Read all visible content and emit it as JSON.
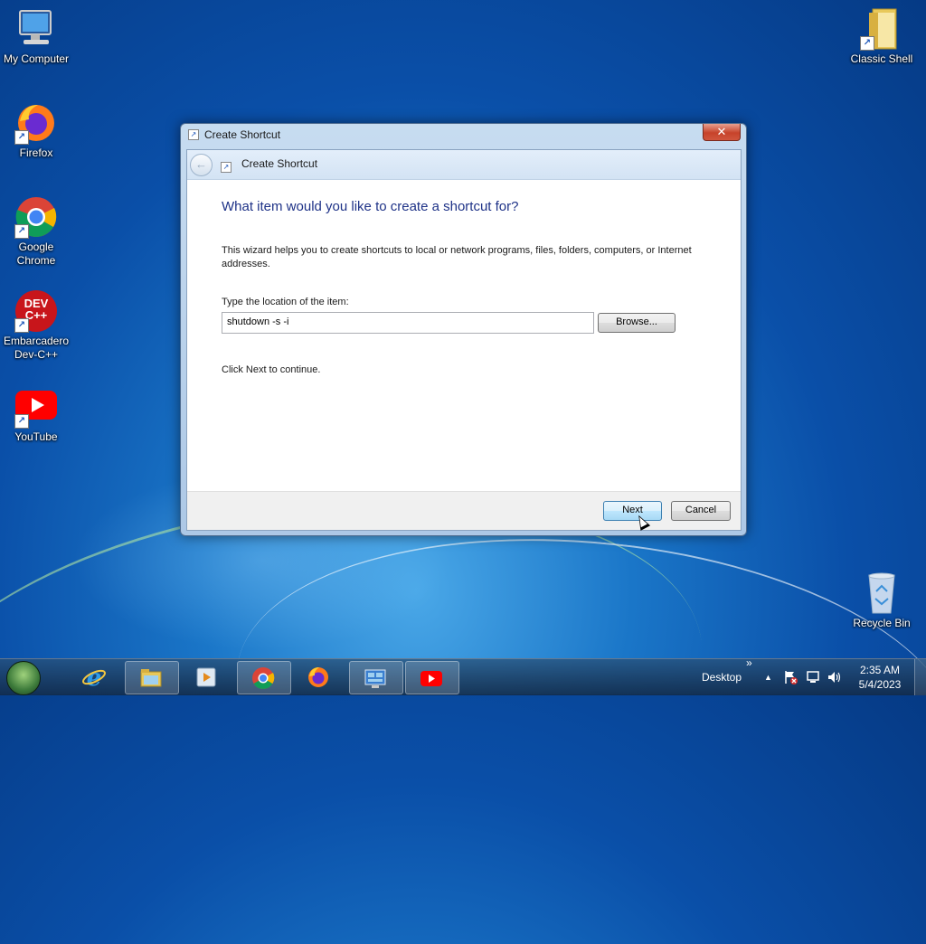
{
  "desktop": {
    "icons": [
      {
        "label": "My Computer",
        "icon": "computer-icon"
      },
      {
        "label": "Firefox",
        "icon": "firefox-icon"
      },
      {
        "label": "Google Chrome",
        "icon": "chrome-icon"
      },
      {
        "label": "Embarcadero Dev-C++",
        "icon": "devcpp-icon"
      },
      {
        "label": "YouTube",
        "icon": "youtube-icon"
      },
      {
        "label": "Classic Shell",
        "icon": "folder-icon"
      },
      {
        "label": "Recycle Bin",
        "icon": "recycle-bin-icon"
      }
    ],
    "devcpp_logo_text": "DEV\nC++"
  },
  "dialog": {
    "title": "Create Shortcut",
    "close_glyph": "✕",
    "nav_title": "Create Shortcut",
    "back_glyph": "←",
    "heading": "What item would you like to create a shortcut for?",
    "description": "This wizard helps you to create shortcuts to local or network programs, files, folders, computers, or Internet addresses.",
    "location_label": "Type the location of the item:",
    "location_value": "shutdown -s -i",
    "browse_label": "Browse...",
    "continue_text": "Click Next to continue.",
    "next_label": "Next",
    "cancel_label": "Cancel"
  },
  "taskbar": {
    "items": [
      {
        "icon": "internet-explorer-icon",
        "pinned": false
      },
      {
        "icon": "file-explorer-icon",
        "pinned": true
      },
      {
        "icon": "media-player-icon",
        "pinned": false
      },
      {
        "icon": "chrome-icon",
        "pinned": true
      },
      {
        "icon": "firefox-icon",
        "pinned": false
      },
      {
        "icon": "control-panel-icon",
        "pinned": true
      },
      {
        "icon": "youtube-icon",
        "pinned": true
      }
    ],
    "desktop_label": "Desktop",
    "chevron": "»",
    "tray_up": "▲",
    "clock_time": "2:35 AM",
    "clock_date": "5/4/2023"
  },
  "colors": {
    "heading": "#1e3287",
    "desktop_bg": "#1a76c8",
    "close_button": "#c7432b"
  }
}
